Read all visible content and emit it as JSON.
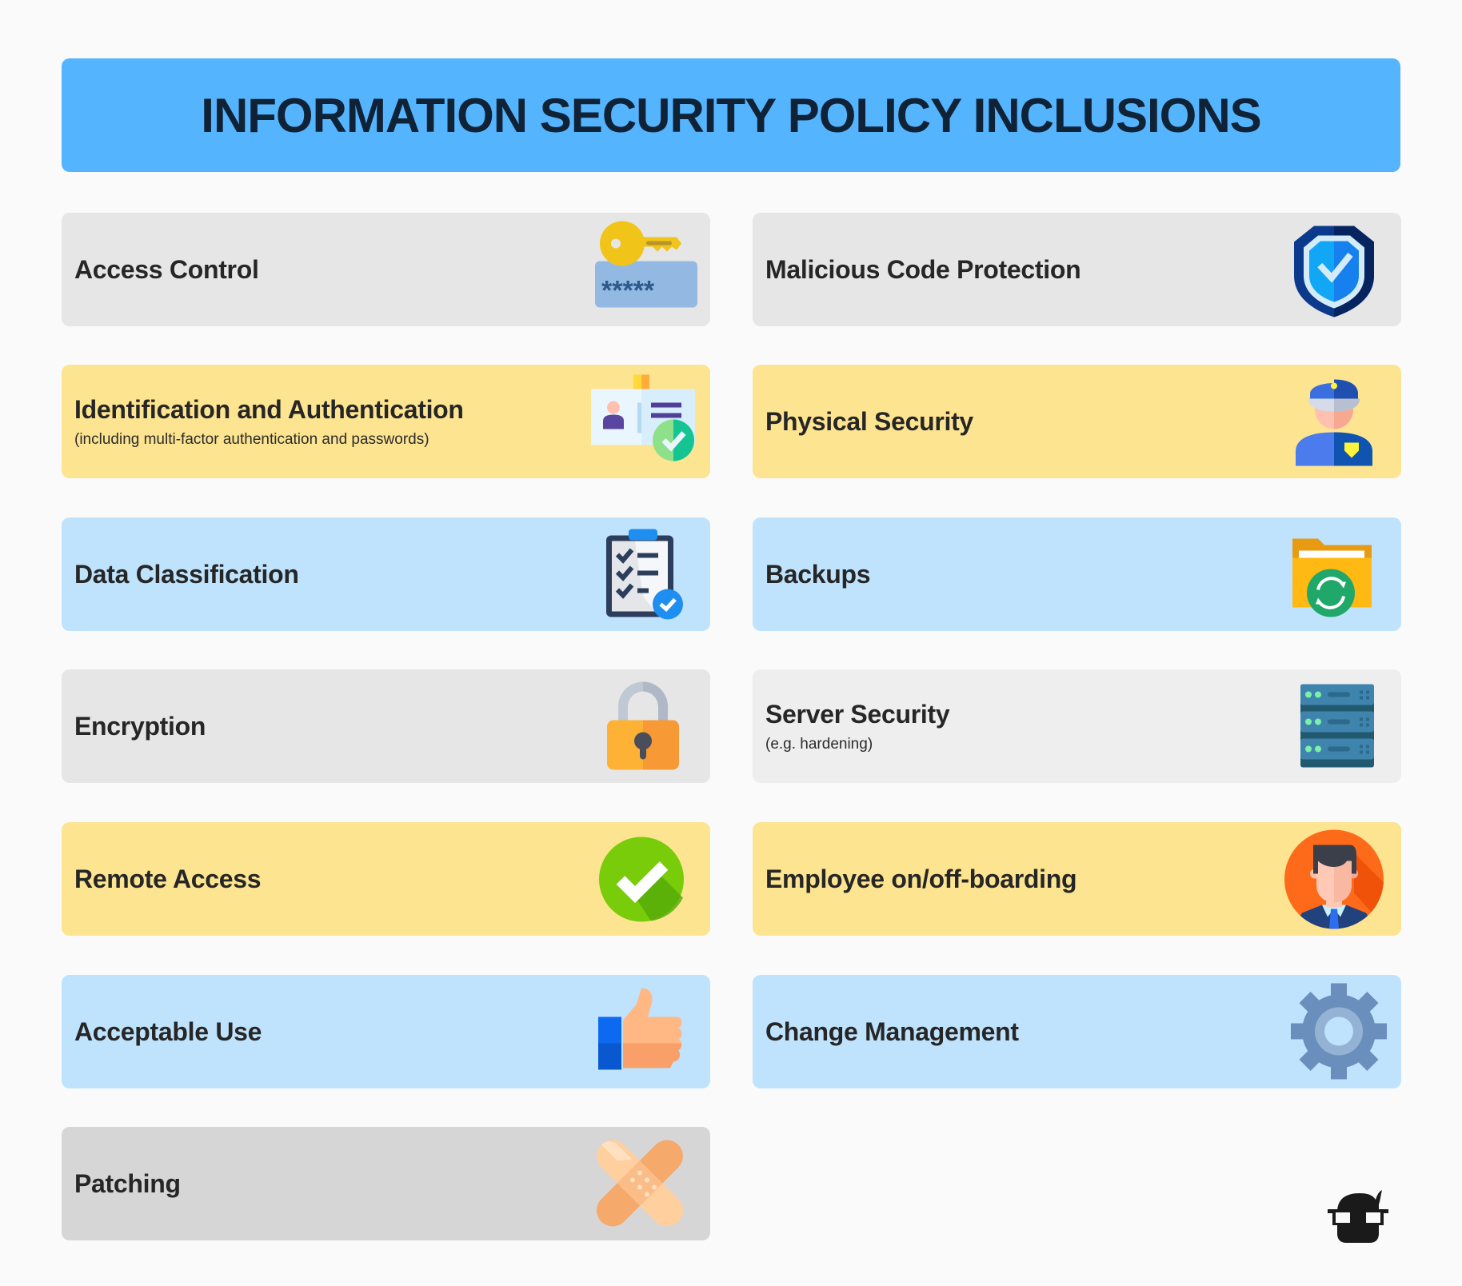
{
  "title": "INFORMATION SECURITY POLICY INCLUSIONS",
  "colors": {
    "title_bg": "#55b4fe",
    "title_text": "#0f2236",
    "card_gray": "#e6e6e6",
    "card_yellow": "#fde490",
    "card_blue": "#bfe3fd"
  },
  "items": [
    {
      "label": "Access Control",
      "sub": "",
      "icon": "key-password-icon"
    },
    {
      "label": "Malicious Code Protection",
      "sub": "",
      "icon": "shield-check-icon"
    },
    {
      "label": "Identification and Authentication",
      "sub": "(including multi-factor authentication and passwords)",
      "icon": "id-card-check-icon"
    },
    {
      "label": "Physical Security",
      "sub": "",
      "icon": "security-guard-icon"
    },
    {
      "label": "Data Classification",
      "sub": "",
      "icon": "clipboard-checklist-icon"
    },
    {
      "label": "Backups",
      "sub": "",
      "icon": "folder-sync-icon"
    },
    {
      "label": "Encryption",
      "sub": "",
      "icon": "padlock-icon"
    },
    {
      "label": "Server Security",
      "sub": "(e.g. hardening)",
      "icon": "server-rack-icon"
    },
    {
      "label": "Remote Access",
      "sub": "",
      "icon": "check-circle-icon"
    },
    {
      "label": "Employee on/off-boarding",
      "sub": "",
      "icon": "employee-avatar-icon"
    },
    {
      "label": "Acceptable Use",
      "sub": "",
      "icon": "thumbs-up-icon"
    },
    {
      "label": "Change Management",
      "sub": "",
      "icon": "gear-icon"
    },
    {
      "label": "Patching",
      "sub": "",
      "icon": "bandage-icon"
    }
  ],
  "logo": "nerd-glasses-logo-icon"
}
